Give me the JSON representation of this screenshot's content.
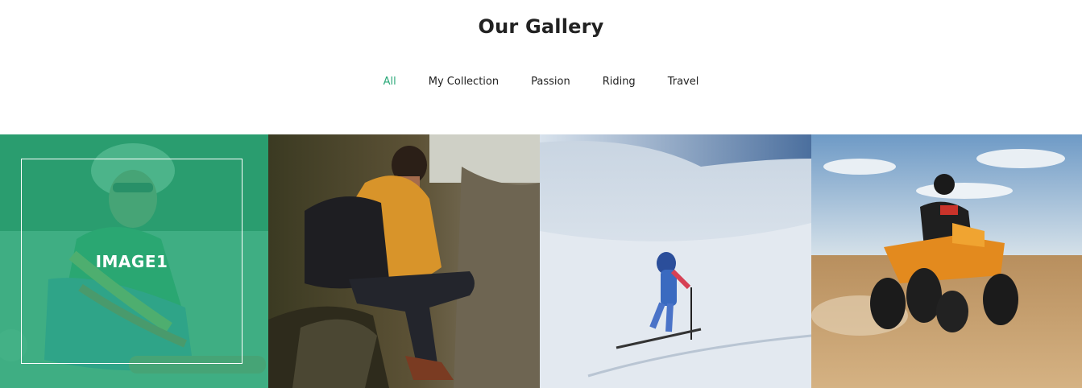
{
  "gallery_title": "Our Gallery",
  "filters": [
    {
      "label": "All",
      "active": true
    },
    {
      "label": "My Collection",
      "active": false
    },
    {
      "label": "Passion",
      "active": false
    },
    {
      "label": "Riding",
      "active": false
    },
    {
      "label": "Travel",
      "active": false
    }
  ],
  "images": [
    {
      "caption": "IMAGE1",
      "subject": "woman-sitting-on-beach"
    },
    {
      "subject": "hiker-with-backpack-on-cliff"
    },
    {
      "subject": "skier-climbing-snow-slope"
    },
    {
      "subject": "rider-on-quad-bike-in-desert"
    }
  ],
  "colors": {
    "accent": "#2aa878",
    "title_text": "#222222",
    "overlay": "rgba(42,168,120,0.82)"
  }
}
